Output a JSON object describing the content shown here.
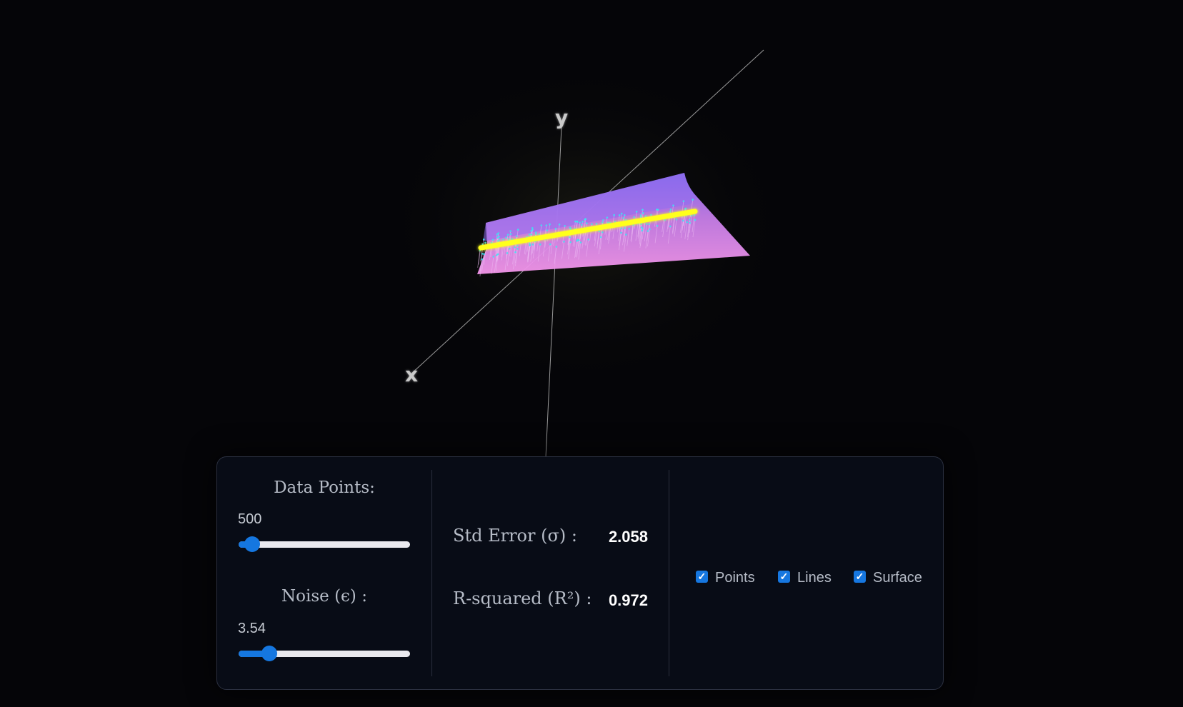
{
  "axes": {
    "x_label": "x",
    "y_label": "y"
  },
  "controls": {
    "data_points": {
      "label": "Data Points:",
      "value": "500",
      "fraction": 0.08
    },
    "noise": {
      "label": "Noise (ϵ) :",
      "value": "3.54",
      "fraction": 0.18
    }
  },
  "stats": {
    "std_error": {
      "label": "Std Error (σ) :",
      "value": "2.058"
    },
    "r_squared": {
      "label": "R-squared (R²) :",
      "value": "0.972"
    }
  },
  "toggles": [
    {
      "label": "Points",
      "checked": true
    },
    {
      "label": "Lines",
      "checked": true
    },
    {
      "label": "Surface",
      "checked": true
    }
  ],
  "colors": {
    "background": "#050508",
    "surface": "#e98ce6",
    "surface_top": "#9a6ff0",
    "regression_line": "#ffff1e",
    "points": "#39e5f3",
    "accent": "#1577e0"
  }
}
